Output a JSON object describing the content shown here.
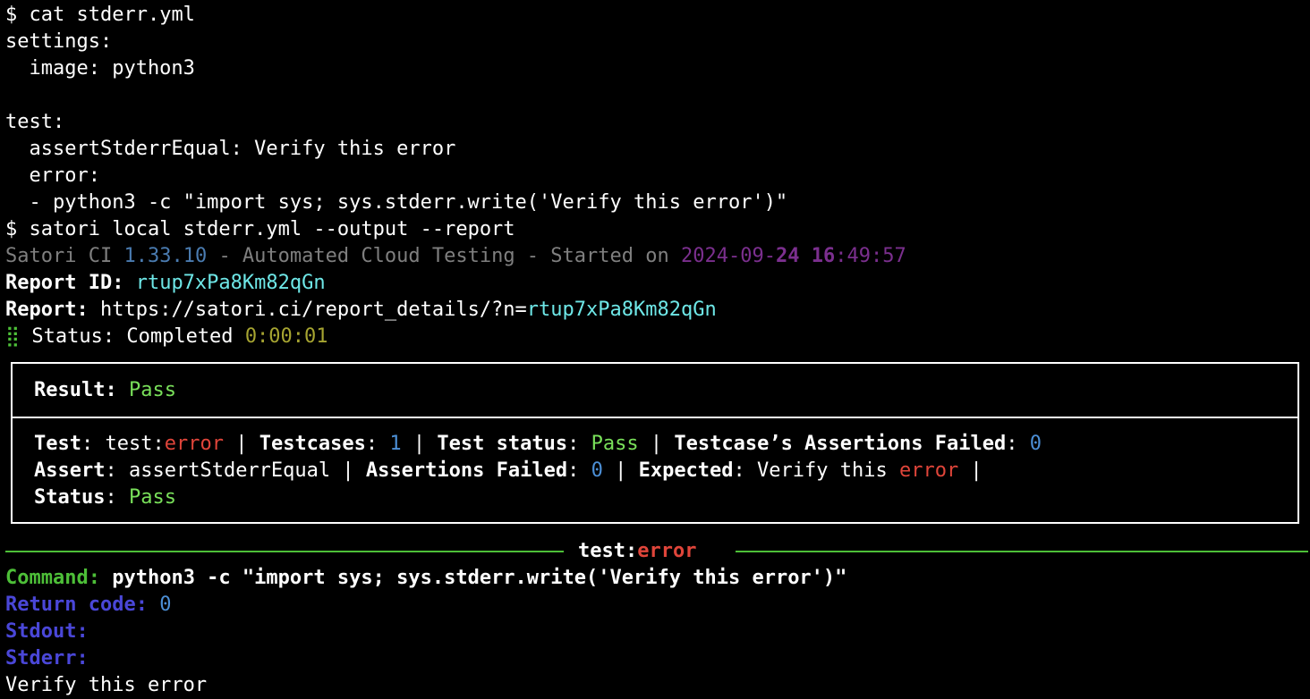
{
  "terminal": {
    "cmd1": {
      "prompt": "$",
      "command": "cat stderr.yml"
    },
    "yaml": [
      "settings:",
      "  image: python3",
      "",
      "test:",
      "  assertStderrEqual: Verify this error",
      "  error:",
      "  - python3 -c \"import sys; sys.stderr.write('Verify this error')\""
    ],
    "cmd2": {
      "prompt": "$",
      "command": "satori local stderr.yml --output --report"
    },
    "banner": {
      "product": "Satori CI",
      "version": "1.33.10",
      "tagline": "- Automated Cloud Testing - Started on",
      "date_prefix": "2024-09-",
      "date_day": "24",
      "date_hour": "16",
      "date_sep": ":",
      "time_rest": "49:57"
    },
    "report_id": {
      "label": "Report ID:",
      "value": "rtup7xPa8Km82qGn"
    },
    "report": {
      "label": "Report:",
      "url_base": "https://satori.ci/report_details/?n=",
      "url_id": "rtup7xPa8Km82qGn"
    },
    "status": {
      "spinner": "⣿",
      "label": "Status:",
      "value": "Completed",
      "elapsed": "0:00:01"
    }
  },
  "result_box": {
    "result_label": "Result:",
    "result_value": "Pass",
    "row1": {
      "test_label": "Test",
      "test_name_prefix": "test:",
      "test_name_suffix": "error",
      "testcases_label": "Testcases",
      "testcases_value": "1",
      "test_status_label": "Test status",
      "test_status_value": "Pass",
      "assertions_failed_label": "Testcase’s Assertions Failed",
      "assertions_failed_value": "0"
    },
    "row2": {
      "assert_label": "Assert",
      "assert_value": "assertStderrEqual",
      "failed_label": "Assertions Failed",
      "failed_value": "0",
      "expected_label": "Expected",
      "expected_prefix": "Verify this",
      "expected_suffix": "error"
    },
    "row3": {
      "status_label": "Status",
      "status_value": "Pass"
    }
  },
  "section": {
    "title_prefix": "test:",
    "title_suffix": "error",
    "command_label": "Command:",
    "command_value": "python3 -c \"import sys; sys.stderr.write('Verify this error')\"",
    "return_code_label": "Return code:",
    "return_code_value": "0",
    "stdout_label": "Stdout:",
    "stderr_label": "Stderr:",
    "stderr_output": "Verify this error"
  }
}
